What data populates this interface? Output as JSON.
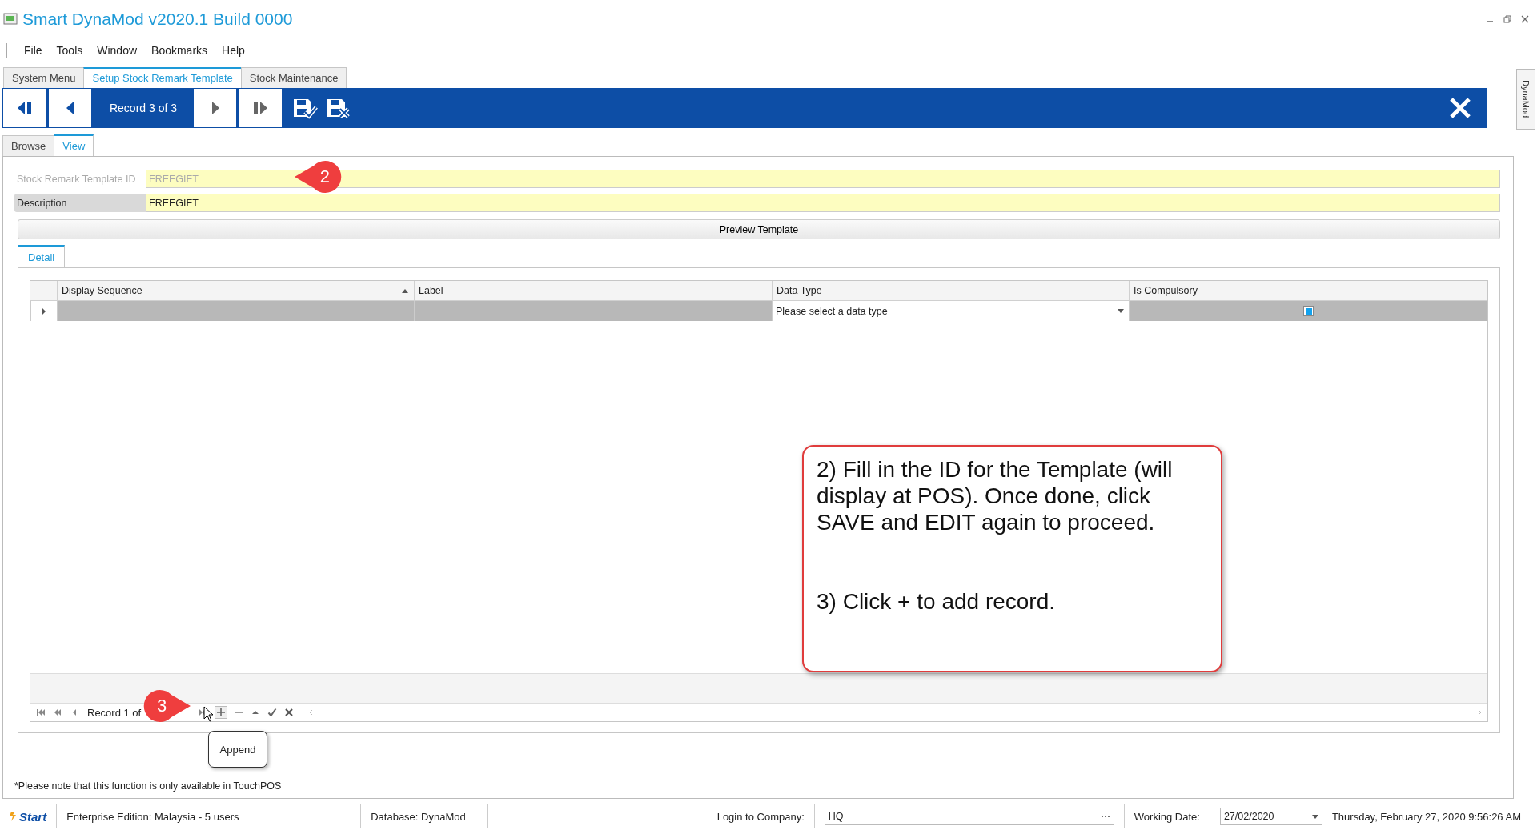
{
  "window": {
    "title": "Smart DynaMod v2020.1 Build 0000"
  },
  "menu": [
    "File",
    "Tools",
    "Window",
    "Bookmarks",
    "Help"
  ],
  "tabs": [
    {
      "label": "System Menu",
      "selected": false
    },
    {
      "label": "Setup Stock Remark Template",
      "selected": true
    },
    {
      "label": "Stock Maintenance",
      "selected": false
    }
  ],
  "toolbar": {
    "record": "Record 3 of 3"
  },
  "side_tab": "DynaMod",
  "view_tabs": [
    {
      "label": "Browse",
      "selected": false
    },
    {
      "label": "View",
      "selected": true
    }
  ],
  "fields": [
    {
      "label": "Stock Remark Template ID",
      "value": "FREEGIFT",
      "disabled": true,
      "focused": false
    },
    {
      "label": "Description",
      "value": "FREEGIFT",
      "disabled": false,
      "focused": true
    }
  ],
  "preview_button": "Preview Template",
  "detail_tabs": [
    {
      "label": "Detail",
      "selected": true
    }
  ],
  "grid": {
    "columns": [
      {
        "label": "Display Sequence",
        "sorted": true
      },
      {
        "label": "Label"
      },
      {
        "label": "Data Type"
      },
      {
        "label": "Is Compulsory"
      }
    ],
    "rows": [
      {
        "current": true,
        "data_type_placeholder": "Please select a data type",
        "is_compulsory_indeterminate": true
      }
    ]
  },
  "navigator": {
    "record": "Record 1 of"
  },
  "tooltip": "Append",
  "note": "*Please note that this function is only available in TouchPOS",
  "callouts": [
    {
      "number": "2"
    },
    {
      "number": "3"
    }
  ],
  "annotation": {
    "paragraphs": [
      "2) Fill in the ID for the Template (will display at POS). Once done, click SAVE and EDIT again to proceed.",
      "3) Click + to add record."
    ]
  },
  "status_bar": {
    "start": "Start",
    "edition": "Enterprise Edition: Malaysia - 5 users",
    "database": "Database: DynaMod",
    "company_label": "Login to Company:",
    "company": "HQ",
    "date_label": "Working Date:",
    "date": "27/02/2020",
    "datetime": "Thursday, February 27, 2020 9:56:26 AM"
  }
}
